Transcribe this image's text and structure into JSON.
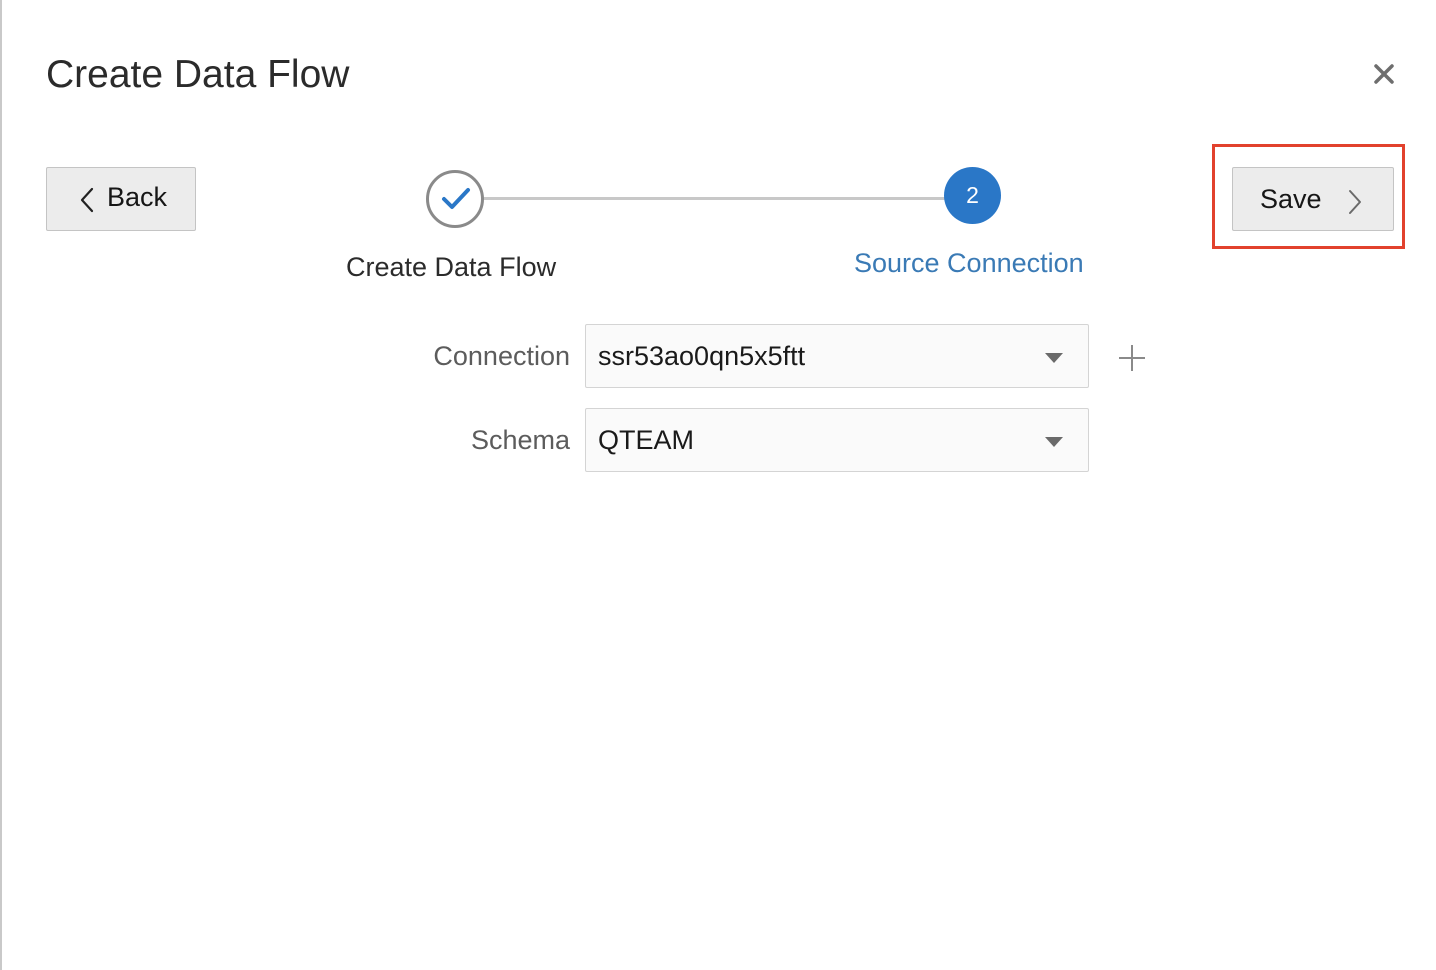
{
  "dialog": {
    "title": "Create Data Flow",
    "close_icon": "close-icon"
  },
  "nav": {
    "back_label": "Back",
    "save_label": "Save"
  },
  "train": {
    "steps": [
      {
        "label": "Create Data Flow",
        "state": "completed",
        "icon": "check-icon"
      },
      {
        "label": "Source Connection",
        "number": "2",
        "state": "current"
      }
    ]
  },
  "form": {
    "connection": {
      "label": "Connection",
      "value": "ssr53ao0qn5x5ftt"
    },
    "schema": {
      "label": "Schema",
      "value": "QTEAM"
    }
  },
  "colors": {
    "accent": "#2a77c7",
    "current_step_text": "#3a7ab5",
    "highlight": "#e2412d"
  }
}
